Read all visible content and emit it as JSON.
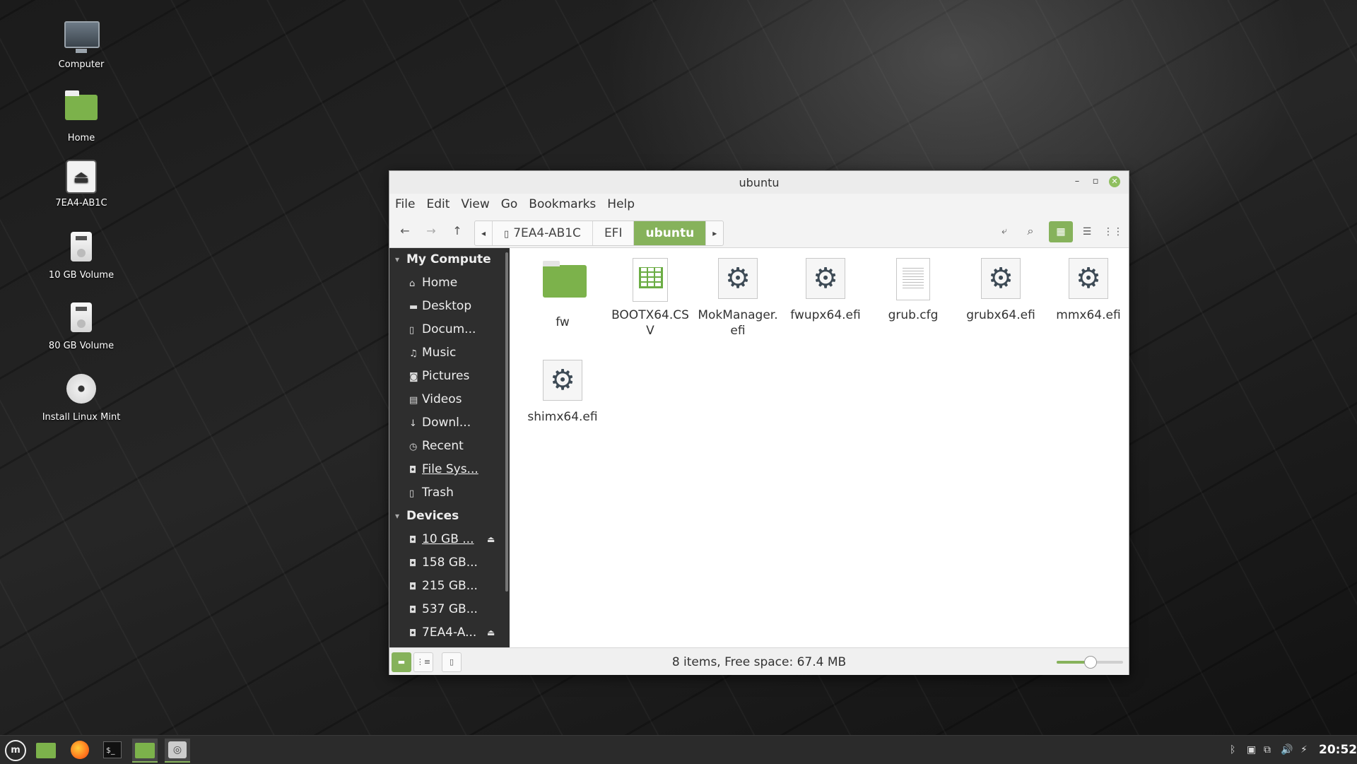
{
  "desktop": {
    "icons": [
      {
        "label": "Computer"
      },
      {
        "label": "Home"
      },
      {
        "label": "7EA4-AB1C"
      },
      {
        "label": "10 GB Volume"
      },
      {
        "label": "80 GB Volume"
      },
      {
        "label": "Install Linux Mint"
      }
    ]
  },
  "window": {
    "title": "ubuntu",
    "controls": {
      "minimize": "–",
      "maximize": "▫",
      "close": "✕"
    },
    "menu": [
      "File",
      "Edit",
      "View",
      "Go",
      "Bookmarks",
      "Help"
    ],
    "toolbar": {
      "back_icon": "←",
      "forward_icon": "→",
      "up_icon": "↑",
      "crumb_left_arrow": "◂",
      "crumb_right_arrow": "▸",
      "breadcrumbs": [
        "7EA4-AB1C",
        "EFI",
        "ubuntu"
      ],
      "toggle_location_icon": "⤶",
      "search_icon": "⌕",
      "view_icons": "▦",
      "view_list": "☰",
      "view_compact": "⋮⋮"
    },
    "sidebar": {
      "sections": [
        {
          "title": "My Compute",
          "items": [
            {
              "icon": "⌂",
              "label": "Home"
            },
            {
              "icon": "▬",
              "label": "Desktop"
            },
            {
              "icon": "▯",
              "label": "Docum..."
            },
            {
              "icon": "♫",
              "label": "Music"
            },
            {
              "icon": "◙",
              "label": "Pictures"
            },
            {
              "icon": "▤",
              "label": "Videos"
            },
            {
              "icon": "↓",
              "label": "Downl..."
            },
            {
              "icon": "◷",
              "label": "Recent"
            },
            {
              "icon": "◘",
              "label": "File Sys..."
            },
            {
              "icon": "▯",
              "label": "Trash"
            }
          ]
        },
        {
          "title": "Devices",
          "items": [
            {
              "icon": "◘",
              "label": "10 GB ...",
              "eject": "⏏"
            },
            {
              "icon": "◘",
              "label": "158 GB..."
            },
            {
              "icon": "◘",
              "label": "215 GB..."
            },
            {
              "icon": "◘",
              "label": "537 GB..."
            },
            {
              "icon": "◘",
              "label": "7EA4-A...",
              "eject": "⏏"
            }
          ]
        }
      ]
    },
    "files": [
      {
        "name": "fw",
        "type": "folder"
      },
      {
        "name": "BOOTX64.CSV",
        "type": "spreadsheet"
      },
      {
        "name": "MokManager.efi",
        "type": "executable"
      },
      {
        "name": "fwupx64.efi",
        "type": "executable"
      },
      {
        "name": "grub.cfg",
        "type": "text"
      },
      {
        "name": "grubx64.efi",
        "type": "executable"
      },
      {
        "name": "mmx64.efi",
        "type": "executable"
      },
      {
        "name": "shimx64.efi",
        "type": "executable"
      }
    ],
    "status": {
      "text": "8 items, Free space: 67.4 MB",
      "btn_places": "▬",
      "btn_tree": "⋮≡",
      "btn_hide": "▯",
      "zoom_level": 0.5
    }
  },
  "taskbar": {
    "menu_icon": "m",
    "terminal_text": "$_",
    "disk_icon": "◎",
    "tray": [
      "ᛒ",
      "▣",
      "⧉",
      "🔊",
      "⚡"
    ],
    "clock": "20:52"
  },
  "colors": {
    "accent": "#86b25b",
    "sidebar_bg": "#2e2e2e"
  }
}
